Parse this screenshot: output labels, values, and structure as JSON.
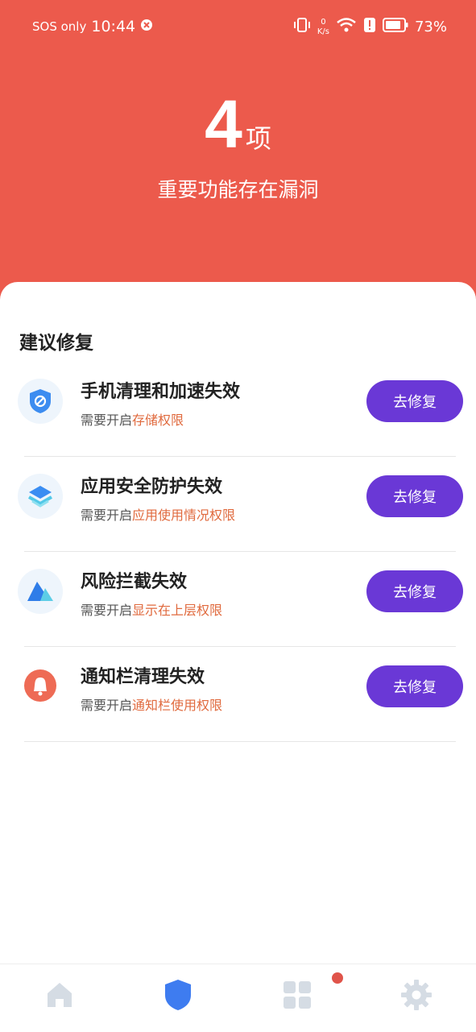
{
  "status_bar": {
    "sos": "SOS only",
    "time": "10:44",
    "net_speed_value": "0",
    "net_speed_unit": "K/s",
    "battery": "73%"
  },
  "header": {
    "count": "4",
    "count_unit": "项",
    "subtitle": "重要功能存在漏洞"
  },
  "section": {
    "title": "建议修复"
  },
  "items": [
    {
      "title": "手机清理和加速失效",
      "prefix": "需要开启",
      "permission": "存储权限",
      "button": "去修复",
      "icon": "shield-clean-icon"
    },
    {
      "title": "应用安全防护失效",
      "prefix": "需要开启",
      "permission": "应用使用情况权限",
      "button": "去修复",
      "icon": "layers-icon"
    },
    {
      "title": "风险拦截失效",
      "prefix": "需要开启",
      "permission": "显示在上层权限",
      "button": "去修复",
      "icon": "triangle-icon"
    },
    {
      "title": "通知栏清理失效",
      "prefix": "需要开启",
      "permission": "通知栏使用权限",
      "button": "去修复",
      "icon": "bell-icon"
    }
  ],
  "nav": {
    "items": [
      "home-icon",
      "shield-icon",
      "apps-grid-icon",
      "gear-icon"
    ],
    "active_color": "#3E7CF0",
    "inactive_color": "#D5DCE4"
  },
  "colors": {
    "hero": "#EC5A4C",
    "button": "#6A38D6",
    "permission_text": "#E06A3E"
  }
}
